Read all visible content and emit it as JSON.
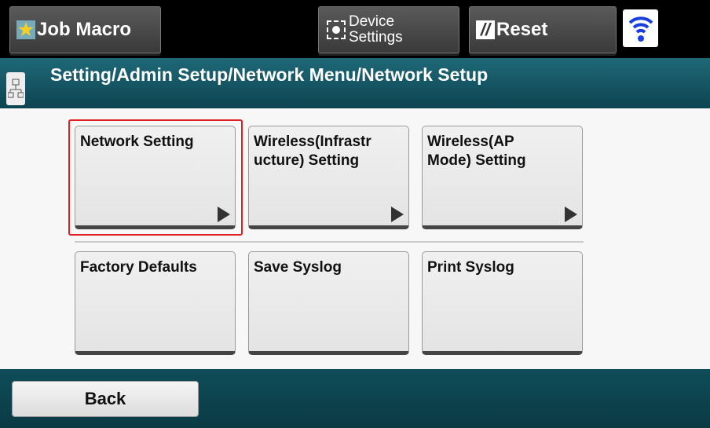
{
  "topbar": {
    "job_macro": "Job Macro",
    "device_settings_line1": "Device",
    "device_settings_line2": "Settings",
    "reset": "Reset"
  },
  "header": {
    "breadcrumb": "Setting/Admin Setup/Network Menu/Network Setup"
  },
  "menu": [
    {
      "label": "Network Setting",
      "has_submenu": true,
      "selected": true
    },
    {
      "label": "Wireless(Infrastr ucture) Setting",
      "has_submenu": true
    },
    {
      "label": "Wireless(AP Mode) Setting",
      "has_submenu": true
    },
    {
      "label": "Factory Defaults"
    },
    {
      "label": "Save Syslog"
    },
    {
      "label": "Print Syslog"
    }
  ],
  "footer": {
    "back": "Back"
  },
  "colors": {
    "selection": "#e02020",
    "header": "#1f6878"
  }
}
